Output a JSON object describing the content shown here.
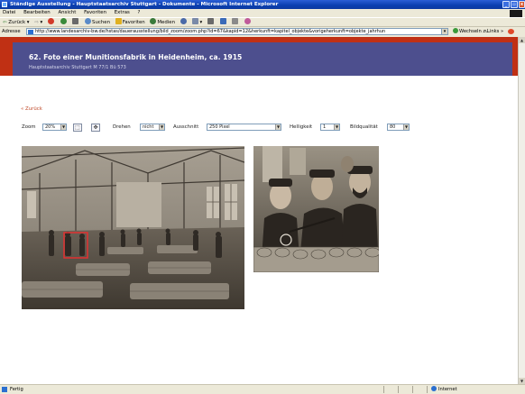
{
  "window": {
    "title": "Ständige Ausstellung - Hauptstaatsarchiv Stuttgart - Dokumente - Microsoft Internet Explorer",
    "controls": {
      "minimize": "_",
      "maximize": "▫",
      "close": "x"
    }
  },
  "menu": [
    "Datei",
    "Bearbeiten",
    "Ansicht",
    "Favoriten",
    "Extras",
    "?"
  ],
  "toolbar": {
    "back": "Zurück",
    "search": "Suchen",
    "favorites": "Favoriten",
    "media": "Medien"
  },
  "address": {
    "label": "Adresse",
    "url": "http://www.landesarchiv-bw.de/hstas/dauerausstellung/bild_zoom/zoom.php?id=67&kapid=12&herkunft=kapitel_objekte&vorigeherkunft=objekte_jahrhun",
    "go": "Wechseln zu",
    "links": "Links"
  },
  "page": {
    "title": "62. Foto einer Munitionsfabrik in Heidenheim, ca. 1915",
    "subtitle": "Hauptstaatsarchiv Stuttgart M 77/1 Bü 573",
    "back_link": "« Zurück"
  },
  "controls": {
    "zoom_label": "Zoom",
    "zoom_value": "20%",
    "rotate_label": "Drehen",
    "rotate_value": "nicht",
    "crop_label": "Ausschnitt",
    "crop_value": "250 Pixel",
    "brightness_label": "Helligkeit",
    "brightness_value": "1",
    "quality_label": "Bildqualität",
    "quality_value": "80"
  },
  "status": {
    "text": "Fertig",
    "zone": "Internet"
  }
}
